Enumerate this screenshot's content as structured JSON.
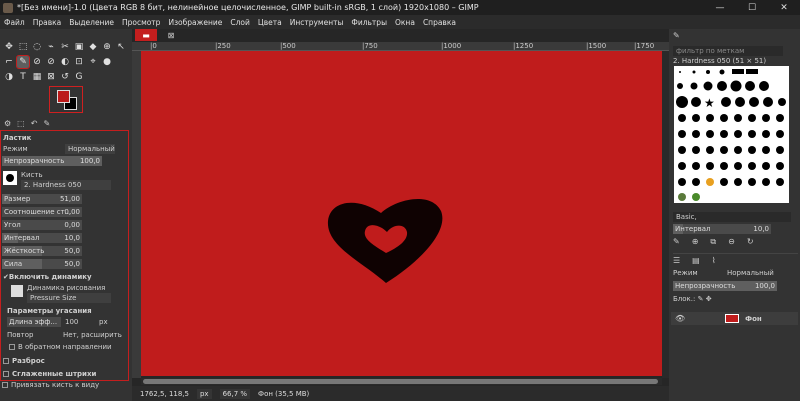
{
  "window": {
    "title": "*[Без имени]-1.0 (Цвета RGB 8 бит, нелинейное целочисленное, GIMP built-in sRGB, 1 слой) 1920x1080 – GIMP",
    "minimize": "—",
    "maximize": "☐",
    "close": "✕"
  },
  "menu": [
    "Файл",
    "Правка",
    "Выделение",
    "Просмотр",
    "Изображение",
    "Слой",
    "Цвета",
    "Инструменты",
    "Фильтры",
    "Окна",
    "Справка"
  ],
  "toolbox": {
    "tools_row1": [
      "✥",
      "⬚",
      "◌",
      "⌁",
      "✂",
      "▣",
      "◆",
      "⊕",
      "↖"
    ],
    "tools_row2": [
      "⌐",
      "✎",
      "⊘",
      "⊘",
      "◐",
      "⊡",
      "⌖",
      "●"
    ],
    "tools_row3": [
      "◑",
      "T",
      "▦",
      "⊠",
      "↺",
      "G"
    ],
    "fg_color": "#bb1a1a",
    "bg_color": "#000000",
    "dock_tabs": [
      "⚙",
      "⬚",
      "↶",
      "✎"
    ]
  },
  "tool_options": {
    "title": "Ластик",
    "mode_label": "Режим",
    "mode_value": "Нормальный",
    "opacity_label": "Непрозрачность",
    "opacity_value": "100,0",
    "brush_label": "Кисть",
    "brush_value": "2. Hardness 050",
    "size_label": "Размер",
    "size_value": "51,00",
    "ratio_label": "Соотношение ст...",
    "ratio_value": "0,00",
    "angle_label": "Угол",
    "angle_value": "0,00",
    "spacing_label": "Интервал",
    "spacing_value": "10,0",
    "hardness_label": "Жёсткость",
    "hardness_value": "50,0",
    "force_label": "Сила",
    "force_value": "50,0",
    "dynamics_toggle": "Включить динамику",
    "dynamics_label": "Динамика рисования",
    "dynamics_value": "Pressure Size",
    "fade_title": "Параметры угасания",
    "fade_length_label": "Длина эфф...",
    "fade_length_value": "100",
    "fade_length_unit": "px",
    "repeat_label": "Повтор",
    "repeat_value": "Нет, расширить",
    "reverse_label": "В обратном направлении",
    "scatter_label": "Разброс",
    "smooth_label": "Сглаженные штрихи",
    "lock_label": "Привязать кисть к виду"
  },
  "ruler": {
    "h_labels": [
      "|0",
      "|250",
      "|500",
      "|750",
      "|1000",
      "|1250",
      "|1500",
      "|1750"
    ]
  },
  "canvas": {
    "image_color": "#c01c1c"
  },
  "status": {
    "coords": "1762,5, 118,5",
    "unit": "px",
    "zoom": "66,7 %",
    "info": "Фон (35,5 МВ)"
  },
  "right_panel": {
    "filter_placeholder": "фильтр по меткам",
    "brush_name": "2. Hardness 050 (51 × 51)",
    "preset": "Basic,",
    "spacing_label": "Интервал",
    "spacing_value": "10,0",
    "layers_mode_label": "Режим",
    "layers_mode_value": "Нормальный",
    "layers_opacity_label": "Непрозрачность",
    "layers_opacity_value": "100,0",
    "lock_label": "Блок.:",
    "layer_name": "Фон"
  }
}
